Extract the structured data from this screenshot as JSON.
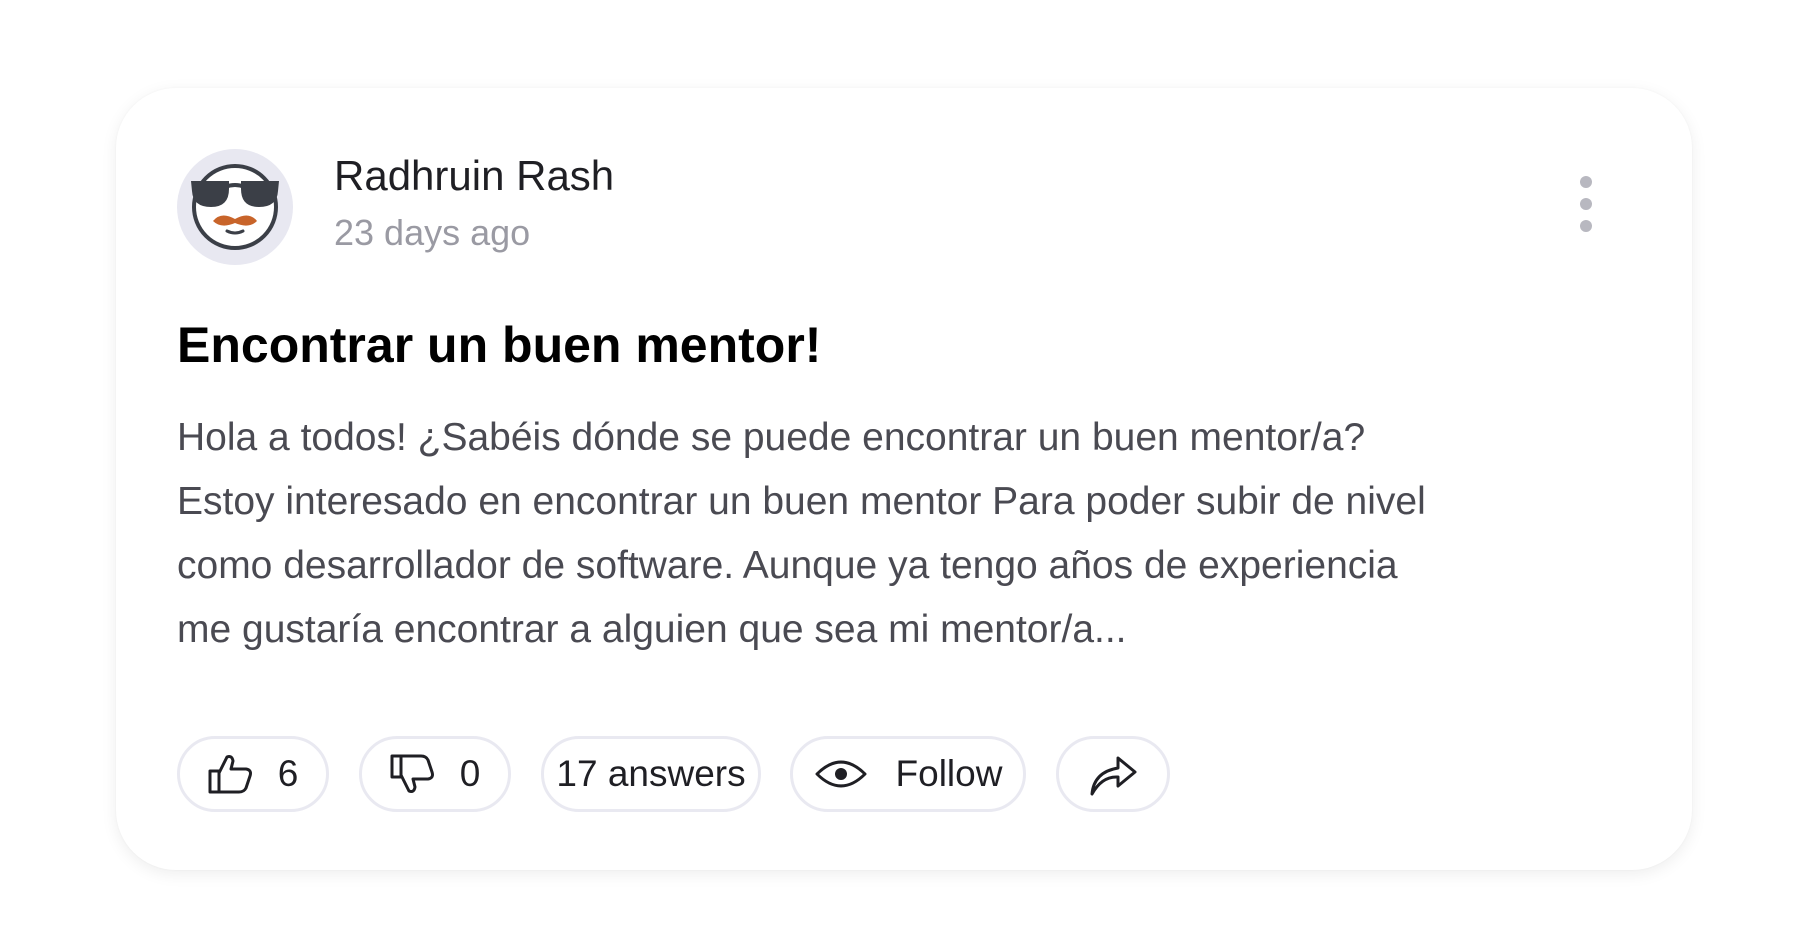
{
  "post": {
    "author": {
      "name": "Radhruin Rash",
      "avatar_icon": "sunglasses-mustache-avatar-icon"
    },
    "time_ago": "23 days ago",
    "title": "Encontrar un buen mentor!",
    "body_lines": [
      "Hola a todos! ¿Sabéis dónde se puede encontrar un buen mentor/a?",
      "Estoy interesado en encontrar un buen mentor Para poder subir de nivel",
      "como desarrollador de software. Aunque ya tengo años de experiencia",
      "me gustaría encontrar a alguien que sea mi mentor/a..."
    ],
    "more_icon": "more-vertical-icon"
  },
  "actions": {
    "likes": "6",
    "like_icon": "thumbs-up-icon",
    "dislikes": "0",
    "dislike_icon": "thumbs-down-icon",
    "answers_label": "17 answers",
    "follow_label": "Follow",
    "follow_icon": "eye-icon",
    "share_icon": "share-arrow-icon"
  },
  "colors": {
    "background": "#ffffff",
    "card": "#ffffff",
    "pill_border": "#e9e9f1",
    "muted_text": "#9a9aa3",
    "body_text": "#4a4a52",
    "avatar_bg": "#e8e8f1",
    "mustache": "#c8642a"
  }
}
